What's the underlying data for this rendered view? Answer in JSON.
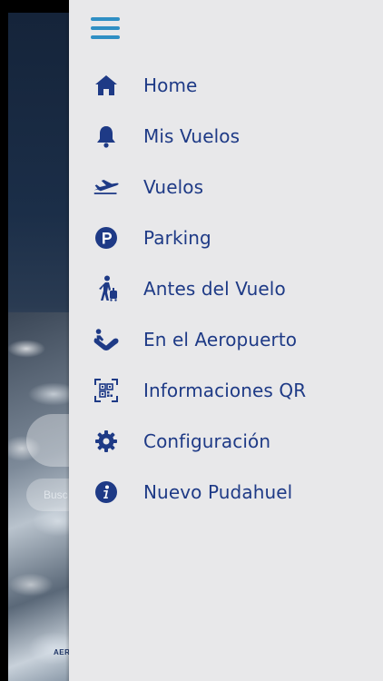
{
  "background": {
    "search_placeholder": "Busc",
    "bottom_logo_text": "AERO"
  },
  "drawer": {
    "menu_icon": "hamburger-icon",
    "items": [
      {
        "label": "Home",
        "icon": "home-icon"
      },
      {
        "label": "Mis Vuelos",
        "icon": "bell-icon"
      },
      {
        "label": "Vuelos",
        "icon": "airplane-icon"
      },
      {
        "label": "Parking",
        "icon": "parking-icon"
      },
      {
        "label": "Antes del Vuelo",
        "icon": "traveler-luggage-icon"
      },
      {
        "label": "En el Aeropuerto",
        "icon": "escalator-icon"
      },
      {
        "label": "Informaciones QR",
        "icon": "qr-scan-icon"
      },
      {
        "label": "Configuración",
        "icon": "gear-icon"
      },
      {
        "label": "Nuevo Pudahuel",
        "icon": "info-icon"
      }
    ]
  },
  "colors": {
    "accent": "#2f8fc4",
    "menu_text": "#1e3a86",
    "drawer_bg": "#e8e8ea"
  }
}
